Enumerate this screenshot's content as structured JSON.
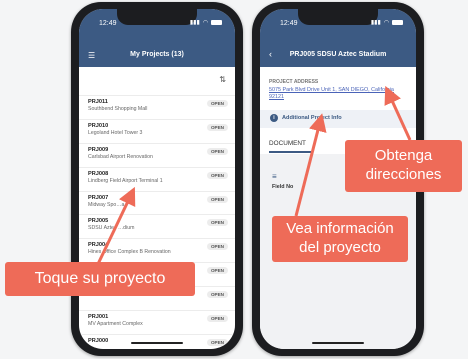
{
  "phone_left": {
    "time": "12:49",
    "title": "My Projects (13)",
    "projects": [
      {
        "code": "PRJ011",
        "name": "Southbend Shopping Mall",
        "status": "OPEN"
      },
      {
        "code": "PRJ010",
        "name": "Legoland Hotel Tower 3",
        "status": "OPEN"
      },
      {
        "code": "PRJ009",
        "name": "Carlsbad Airport Renovation",
        "status": "OPEN"
      },
      {
        "code": "PRJ008",
        "name": "Lindberg Field Airport Terminal 1",
        "status": "OPEN"
      },
      {
        "code": "PRJ007",
        "name": "Midway Spo…a",
        "status": "OPEN"
      },
      {
        "code": "PRJ005",
        "name": "SDSU Aztec …dium",
        "status": "OPEN"
      },
      {
        "code": "PRJ004",
        "name": "Hines Office Complex B Renovation",
        "status": "OPEN"
      },
      {
        "code": "",
        "name": "",
        "status": "OPEN"
      },
      {
        "code": "",
        "name": "Kaiser Hospital New Wing",
        "status": "OPEN"
      },
      {
        "code": "PRJ001",
        "name": "MV Apartment Complex",
        "status": "OPEN"
      },
      {
        "code": "PRJ000",
        "name": "",
        "status": "OPEN"
      }
    ]
  },
  "phone_right": {
    "time": "12:49",
    "title": "PRJ005 SDSU Aztec Stadium",
    "section_label": "PROJECT ADDRESS",
    "address": "5075 Park Blvd Drive Unit 1, SAN DIEGO, California 92121",
    "info_label": "Additional Project Info",
    "tab_label": "DOCUMENT",
    "field_notes": "Field No"
  },
  "callouts": {
    "tap_project": "Toque su proyecto",
    "info_line1": "Vea información",
    "info_line2": "del proyecto",
    "dir_line1": "Obtenga",
    "dir_line2": "direcciones"
  },
  "colors": {
    "header": "#3c5a83",
    "callout": "#ee6b58",
    "arrow": "#ee6b58"
  }
}
